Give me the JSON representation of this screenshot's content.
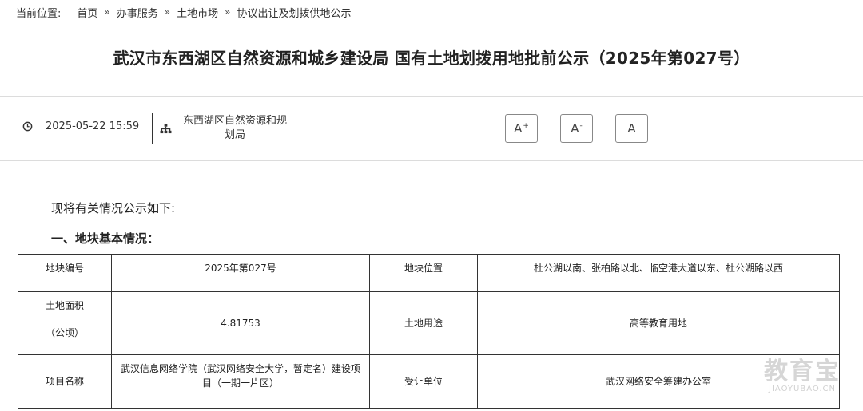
{
  "breadcrumb": {
    "prefix": "当前位置:",
    "items": [
      "首页",
      "办事服务",
      "土地市场",
      "协议出让及划拨供地公示"
    ],
    "separator": "»"
  },
  "article": {
    "title": "武汉市东西湖区自然资源和城乡建设局 国有土地划拨用地批前公示（2025年第027号）",
    "datetime": "2025-05-22 15:59",
    "source": "东西湖区自然资源和规划局",
    "intro": "现将有关情况公示如下:",
    "section1": "一、地块基本情况："
  },
  "font_controls": {
    "increase_base": "A",
    "increase_sup": "+",
    "decrease_base": "A",
    "decrease_sup": "-",
    "reset": "A"
  },
  "table": {
    "rows": [
      {
        "c1": "地块编号",
        "c2": "2025年第027号",
        "c3": "地块位置",
        "c4": "杜公湖以南、张柏路以北、临空港大道以东、杜公湖路以西"
      },
      {
        "c1a": "土地面积",
        "c1b": "（公顷）",
        "c2": "4.81753",
        "c3": "土地用途",
        "c4": "高等教育用地"
      },
      {
        "c1": "项目名称",
        "c2": "武汉信息网络学院（武汉网络安全大学，暂定名）建设项目（一期一片区）",
        "c3": "受让单位",
        "c4": "武汉网络安全筹建办公室"
      }
    ]
  },
  "watermark": {
    "cn": "教育宝",
    "en": "JIAOYUBAO.CN"
  },
  "colors": {
    "text": "#222222",
    "border": "#333333",
    "divider": "#dcdcdc",
    "watermark": "#c9c9c9"
  }
}
